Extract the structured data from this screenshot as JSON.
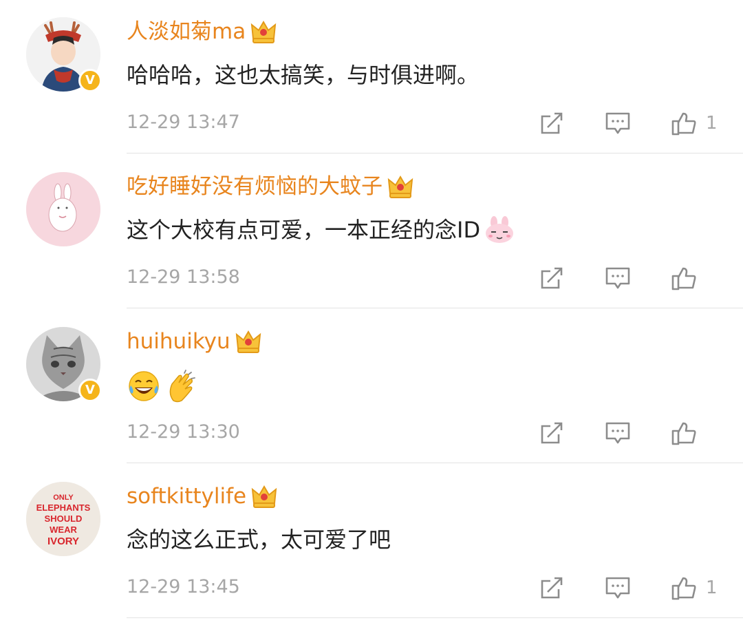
{
  "comments": [
    {
      "username": "人淡如菊ma",
      "text": "哈哈哈，这也太搞笑，与时俱进啊。",
      "time": "12-29 13:47",
      "likes": "1",
      "verified": true
    },
    {
      "username": "吃好睡好没有烦恼的大蚊子",
      "text": "这个大校有点可爱，一本正经的念ID",
      "time": "12-29 13:58",
      "likes": "",
      "verified": false
    },
    {
      "username": "huihuikyu",
      "text": "",
      "time": "12-29 13:30",
      "likes": "",
      "verified": true
    },
    {
      "username": "softkittylife",
      "text": "念的这么正式，太可爱了吧",
      "time": "12-29 13:45",
      "likes": "1",
      "verified": false
    }
  ],
  "avatar4_text": [
    "ONLY",
    "ELEPHANTS",
    "SHOULD",
    "WEAR",
    "IVORY"
  ],
  "icons": {
    "badge": "crown-vip-icon",
    "verified": "verified-v-icon",
    "share": "share-icon",
    "reply": "comment-icon",
    "like": "thumbs-up-icon"
  },
  "colors": {
    "username": "#e8851e",
    "text": "#222222",
    "meta": "#a6a6a6",
    "verified": "#f5b41b"
  }
}
